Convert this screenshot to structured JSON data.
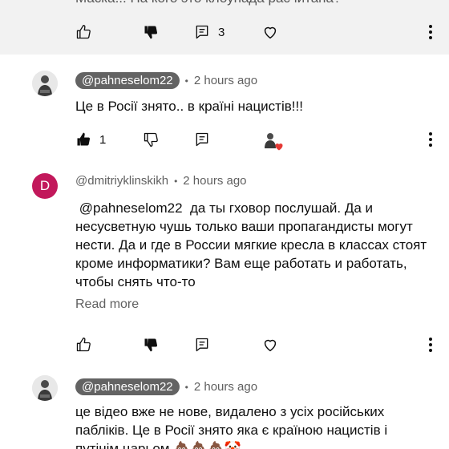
{
  "comments": [
    {
      "text": "Маска... На кого это клоунада расчитана?",
      "likes": "",
      "replies": "3"
    },
    {
      "handle": "@pahneselom22",
      "time": "2 hours ago",
      "text": "Це в Росії знято.. в країні нацистів!!!",
      "likes": "1"
    },
    {
      "avatar_letter": "D",
      "handle": "@dmitriyklinskikh",
      "time": "2 hours ago",
      "text": " @pahneselom22  да ты гховор послушай. Да и несусветную чушь только ваши пропагандисты могут нести. Да и где в России мягкие кресла в классах стоят кроме информатики? Вам еще работать и работать, чтобы снять что-то",
      "read_more": "Read more"
    },
    {
      "handle": "@pahneselom22",
      "time": "2 hours ago",
      "text": "це відео вже не нове, видалено з усіх російських пабліків. Це в Росії знято яка є країною нацистів і путінім царьом 💩💩💩🤡"
    }
  ],
  "colors": {
    "pill": "#636363",
    "letter_avatar": "#c2185b",
    "heart": "#e53935"
  }
}
